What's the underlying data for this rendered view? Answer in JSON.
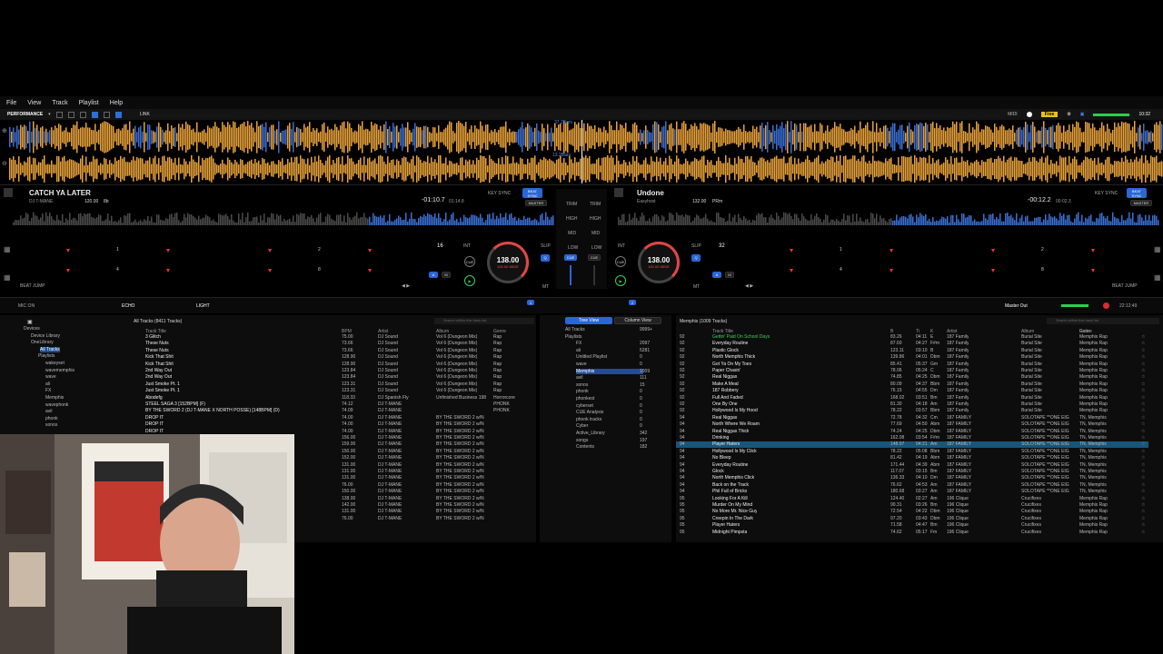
{
  "menu": {
    "items": [
      "File",
      "View",
      "Track",
      "Playlist",
      "Help"
    ]
  },
  "toolbar": {
    "mode": "PERFORMANCE",
    "link": "LINK",
    "midi": "MIDI",
    "free": "Free",
    "clock": "10:32"
  },
  "overview": {
    "top_bars": "37.2Bars",
    "bottom_bars": "13.2Bars"
  },
  "deck1": {
    "title": "CATCH YA LATER",
    "artist": "DJ T-MANE",
    "bpm_text": "120.00",
    "bpm_suffix": "8b",
    "time_remaining": "-01:10.7",
    "time_total": "01:14.8",
    "key_sync": "KEY SYNC",
    "beat_sync": "BEAT SYNC",
    "master": "MASTER",
    "beat_jump": "BEAT JUMP",
    "loop_size": "16",
    "knob_bpm": "138.00",
    "knob_sub": "100.00 WIDE",
    "hotcue_labels": [
      "1",
      "2",
      "4",
      "8"
    ],
    "cue": "CUE",
    "int": "INT",
    "slip": "SLIP",
    "mt": "MT",
    "q": "Q"
  },
  "deck2": {
    "title": "Undone",
    "artist": "Easyhost",
    "bpm_text": "132.00",
    "bpm_suffix": "PRm",
    "time_remaining": "-00:12.2",
    "time_total": "00:02.3",
    "key_sync": "KEY SYNC",
    "beat_sync": "BEAT SYNC",
    "master": "MASTER",
    "beat_jump": "BEAT JUMP",
    "loop_size": "32",
    "knob_bpm": "138.00",
    "knob_sub": "100.00 WIDE",
    "hotcue_labels": [
      "1",
      "2",
      "4",
      "8"
    ],
    "cue": "CUE",
    "int": "INT",
    "slip": "SLIP",
    "mt": "MT",
    "q": "Q"
  },
  "mixer": {
    "labels": [
      "TRIM",
      "TRIM",
      "HIGH",
      "HIGH",
      "MID",
      "MID",
      "LOW",
      "LOW",
      "CUE",
      "CUE"
    ]
  },
  "fxbar": {
    "mic": "MIC ON",
    "echo": "ECHO",
    "light": "LIGHT",
    "master_out": "Master Out",
    "rec_time": "22:12:49"
  },
  "browser_left": {
    "title": "All Tracks (8411 Tracks)",
    "search_placeholder": "Search within this track list",
    "tree": [
      "Devices",
      "Device Library",
      "OneLibrary",
      "All Tracks",
      "Playlists",
      "wakeyset",
      "wavememphis",
      "wave",
      "ali",
      "FX",
      "Memphis",
      "wavephonk",
      "avil",
      "phonk",
      "sonos"
    ],
    "columns": [
      "Track Title",
      "BPM",
      "Artist",
      "Album",
      "Genre"
    ],
    "rows": [
      [
        "3 Glitch",
        "75.00",
        "DJ Sound",
        "Vol 6 (Dungeon Mix)",
        "Rap"
      ],
      [
        "These Nuts",
        "73.66",
        "DJ Sound",
        "Vol 6 (Dungeon Mix)",
        "Rap"
      ],
      [
        "These Nuts",
        "73.66",
        "DJ Sound",
        "Vol 6 (Dungeon Mix)",
        "Rap"
      ],
      [
        "Kick That Shit",
        "128.90",
        "DJ Sound",
        "Vol 6 (Dungeon Mix)",
        "Rap"
      ],
      [
        "Kick That Shit",
        "128.90",
        "DJ Sound",
        "Vol 6 (Dungeon Mix)",
        "Rap"
      ],
      [
        "2nd Way Out",
        "123.84",
        "DJ Sound",
        "Vol 6 (Dungeon Mix)",
        "Rap"
      ],
      [
        "2nd Way Out",
        "123.84",
        "DJ Sound",
        "Vol 6 (Dungeon Mix)",
        "Rap"
      ],
      [
        "Just Smoke Pt. 1",
        "123.31",
        "DJ Sound",
        "Vol 6 (Dungeon Mix)",
        "Rap"
      ],
      [
        "Just Smoke Pt. 1",
        "123.31",
        "DJ Sound",
        "Vol 6 (Dungeon Mix)",
        "Rap"
      ],
      [
        "Abodefg",
        "118.33",
        "DJ Spanish Fly",
        "Unfinished Business 198",
        "Horrorcore"
      ],
      [
        "STEEL SAGA 3 [152BPM] (F)",
        "74.12",
        "DJ T-MANE",
        "",
        "PHONK"
      ],
      [
        "BY THE SWORD 2 (DJ T-MANE X NORTH POSSE) [148BPM] (D)",
        "74.09",
        "DJ T-MANE",
        "",
        "PHONK"
      ],
      [
        "DROP IT",
        "74.00",
        "DJ T-MANE",
        "BY THE SWORD 2 w/N",
        ""
      ],
      [
        "DROP IT",
        "74.00",
        "DJ T-MANE",
        "BY THE SWORD 2 w/N",
        ""
      ],
      [
        "DROP IT",
        "74.00",
        "DJ T-MANE",
        "BY THE SWORD 2 w/N",
        ""
      ],
      [
        "",
        "156.00",
        "DJ T-MANE",
        "BY THE SWORD 2 w/N",
        ""
      ],
      [
        "",
        "159.00",
        "DJ T-MANE",
        "BY THE SWORD 2 w/N",
        ""
      ],
      [
        "",
        "150.00",
        "DJ T-MANE",
        "BY THE SWORD 2 w/N",
        ""
      ],
      [
        "",
        "152.00",
        "DJ T-MANE",
        "BY THE SWORD 2 w/N",
        ""
      ],
      [
        "",
        "131.00",
        "DJ T-MANE",
        "BY THE SWORD 2 w/N",
        ""
      ],
      [
        "",
        "131.00",
        "DJ T-MANE",
        "BY THE SWORD 2 w/N",
        ""
      ],
      [
        "",
        "131.00",
        "DJ T-MANE",
        "BY THE SWORD 2 w/N",
        ""
      ],
      [
        "",
        "76.00",
        "DJ T-MANE",
        "BY THE SWORD 2 w/N",
        ""
      ],
      [
        "",
        "150.00",
        "DJ T-MANE",
        "BY THE SWORD 2 w/N",
        ""
      ],
      [
        "",
        "138.00",
        "DJ T-MANE",
        "BY THE SWORD 2 w/N",
        ""
      ],
      [
        "",
        "142.00",
        "DJ T-MANE",
        "BY THE SWORD 2 w/N",
        ""
      ],
      [
        "",
        "131.00",
        "DJ T-MANE",
        "BY THE SWORD 2 w/N",
        ""
      ],
      [
        "",
        "76.00",
        "DJ T-MANE",
        "BY THE SWORD 2 w/N",
        ""
      ]
    ]
  },
  "browser_mid": {
    "tabs": [
      "Tree View",
      "Column View"
    ],
    "items": [
      [
        "All Tracks",
        "9999+"
      ],
      [
        "Playlists",
        ""
      ],
      [
        "FX",
        "2097"
      ],
      [
        "ali",
        "5281"
      ],
      [
        "Untitled Playlist",
        "0"
      ],
      [
        "wave",
        "0"
      ],
      [
        "Memphis",
        "1009"
      ],
      [
        "avil",
        "111"
      ],
      [
        "sonos",
        "15"
      ],
      [
        "phonk",
        "0"
      ],
      [
        "phonkest",
        "0"
      ],
      [
        "cyberset",
        "0"
      ],
      [
        "CUE Analysis",
        "0"
      ],
      [
        "phonk tracks",
        "0"
      ],
      [
        "Cyber",
        "0"
      ],
      [
        "Active_Library",
        "342"
      ],
      [
        "songs",
        "197"
      ],
      [
        "Contents",
        "182"
      ]
    ]
  },
  "browser_right": {
    "title": "Memphis (1009 Tracks)",
    "search_placeholder": "Search within this track list",
    "columns": [
      "Track Title",
      "B",
      "Ti",
      "K",
      "Artist",
      "Album",
      "Genre",
      "Ratin"
    ],
    "rows": [
      [
        "92",
        "Gettin' Paid On School Days",
        "83.26",
        "04:11",
        "E",
        "187 Family",
        "Burial Site",
        "Memphis Rap"
      ],
      [
        "92",
        "Everyday Routine",
        "87.60",
        "04:27",
        "F#m",
        "187 Family",
        "Burial Site",
        "Memphis Rap"
      ],
      [
        "92",
        "Plastic Glock",
        "123.11",
        "03:10",
        "B",
        "187 Family",
        "Burial Site",
        "Memphis Rap"
      ],
      [
        "92",
        "North Memphis Thick",
        "139.86",
        "04:01",
        "Dbm",
        "187 Family",
        "Burial Site",
        "Memphis Rap"
      ],
      [
        "92",
        "Got Ya On My Toes",
        "85.41",
        "05:37",
        "Gm",
        "187 Family",
        "Burial Site",
        "Memphis Rap"
      ],
      [
        "92",
        "Paper Chasin'",
        "78.06",
        "05:24",
        "C",
        "187 Family",
        "Burial Site",
        "Memphis Rap"
      ],
      [
        "92",
        "Real Niggas",
        "74.85",
        "04:25",
        "Dbm",
        "187 Family",
        "Burial Site",
        "Memphis Rap"
      ],
      [
        "92",
        "Make A Meal",
        "80.09",
        "04:37",
        "Bbm",
        "187 Family",
        "Burial Site",
        "Memphis Rap"
      ],
      [
        "92",
        "187 Robbery",
        "76.15",
        "04:55",
        "Dm",
        "187 Family",
        "Burial Site",
        "Memphis Rap"
      ],
      [
        "92",
        "Full And Faded",
        "168.02",
        "03:51",
        "Bm",
        "187 Family",
        "Burial Site",
        "Memphis Rap"
      ],
      [
        "92",
        "One By One",
        "81.30",
        "04:18",
        "Am",
        "187 Family",
        "Burial Site",
        "Memphis Rap"
      ],
      [
        "92",
        "Hollywood Is My Hood",
        "78.22",
        "03:57",
        "Bbm",
        "187 Family",
        "Burial Site",
        "Memphis Rap"
      ],
      [
        "94",
        "Real Niggas",
        "72.78",
        "04:32",
        "Cm",
        "187 FAMILY",
        "SOLOTAPE **ONE EIG",
        "TN, Memphis"
      ],
      [
        "94",
        "North Where We Roam",
        "77.69",
        "04:50",
        "Abm",
        "187 FAMILY",
        "SOLOTAPE **ONE EIG",
        "TN, Memphis"
      ],
      [
        "94",
        "Real Niggas Thick",
        "74.24",
        "04:25",
        "Dbm",
        "187 FAMILY",
        "SOLOTAPE **ONE EIG",
        "TN, Memphis"
      ],
      [
        "94",
        "Drinking",
        "162.08",
        "03:54",
        "F#m",
        "187 FAMILY",
        "SOLOTAPE **ONE EIG",
        "TN, Memphis"
      ],
      [
        "94",
        "Player Haters",
        "148.07",
        "04:21",
        "Am",
        "187 FAMILY",
        "SOLOTAPE **ONE EIG",
        "TN, Memphis"
      ],
      [
        "94",
        "Hollywood Is My Click",
        "78.22",
        "05:08",
        "Bbm",
        "187 FAMILY",
        "SOLOTAPE **ONE EIG",
        "TN, Memphis"
      ],
      [
        "94",
        "No Bleep",
        "81.42",
        "04:19",
        "Abm",
        "187 FAMILY",
        "SOLOTAPE **ONE EIG",
        "TN, Memphis"
      ],
      [
        "94",
        "Everyday Routine",
        "171.44",
        "04:39",
        "Abm",
        "187 FAMILY",
        "SOLOTAPE **ONE EIG",
        "TN, Memphis"
      ],
      [
        "94",
        "Glock",
        "117.07",
        "03:15",
        "Bm",
        "187 FAMILY",
        "SOLOTAPE **ONE EIG",
        "TN, Memphis"
      ],
      [
        "94",
        "North Memphis Click",
        "136.33",
        "04:10",
        "Dm",
        "187 FAMILY",
        "SOLOTAPE **ONE EIG",
        "TN, Memphis"
      ],
      [
        "94",
        "Back on the Track",
        "76.62",
        "04:53",
        "Am",
        "187 FAMILY",
        "SOLOTAPE **ONE EIG",
        "TN, Memphis"
      ],
      [
        "94",
        "Phil Full of Bricks",
        "180.68",
        "03:27",
        "Am",
        "187 FAMILY",
        "SOLOTAPE **ONE EIG",
        "TN, Memphis"
      ],
      [
        "95",
        "Looking For A Kill",
        "124.40",
        "02:27",
        "Am",
        "196 Clique",
        "Crucifixes",
        "Memphis Rap"
      ],
      [
        "95",
        "Murder On My Mind",
        "90.31",
        "03:26",
        "Bm",
        "196 Clique",
        "Crucifixes",
        "Memphis Rap"
      ],
      [
        "95",
        "No More Mr. Nice Guy",
        "72.54",
        "04:22",
        "Dbm",
        "196 Clique",
        "Crucifixes",
        "Memphis Rap"
      ],
      [
        "95",
        "Creepin In The Dark",
        "97.20",
        "03:43",
        "Dbm",
        "196 Clique",
        "Crucifixes",
        "Memphis Rap"
      ],
      [
        "95",
        "Player Haters",
        "71.58",
        "04:47",
        "Bm",
        "196 Clique",
        "Crucifixes",
        "Memphis Rap"
      ],
      [
        "95",
        "Midnight Pimpsta",
        "74.62",
        "05:17",
        "Fm",
        "196 Clique",
        "Crucifixes",
        "Memphis Rap"
      ]
    ]
  },
  "colors": {
    "accent": "#2a66d6",
    "wave_orange": "#e9a23b",
    "wave_blue": "#3b6fd4",
    "cue_red": "#e03a3a",
    "free_badge": "#e8c21a"
  }
}
